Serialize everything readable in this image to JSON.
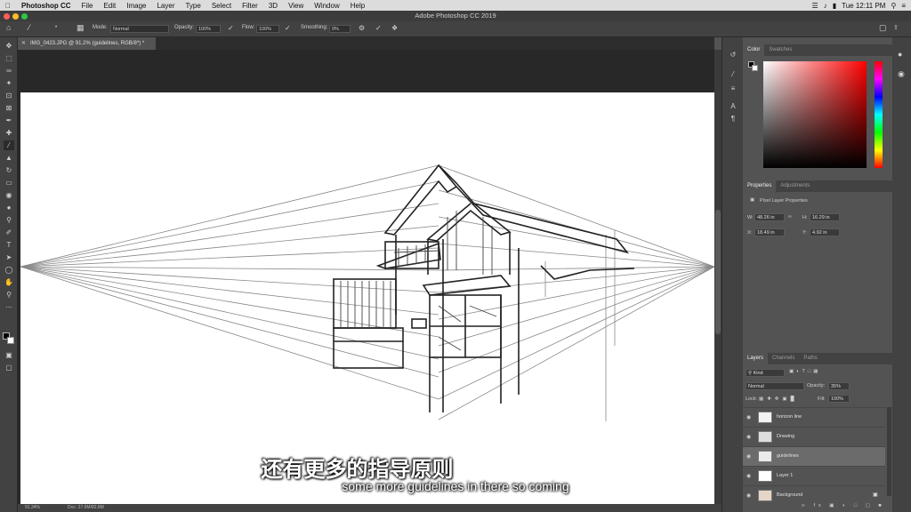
{
  "menubar": {
    "app": "Photoshop CC",
    "items": [
      "File",
      "Edit",
      "Image",
      "Layer",
      "Type",
      "Select",
      "Filter",
      "3D",
      "View",
      "Window",
      "Help"
    ],
    "clock": "Tue 12:11 PM"
  },
  "window": {
    "title": "Adobe Photoshop CC 2019"
  },
  "options": {
    "mode_label": "Mode:",
    "mode_value": "Normal",
    "opacity_label": "Opacity:",
    "opacity_value": "100%",
    "flow_label": "Flow:",
    "flow_value": "100%",
    "smoothing_label": "Smoothing:",
    "smoothing_value": "0%"
  },
  "document": {
    "tab_title": "IMG_0423.JPG @ 91.2% (guidelines, RGB/8*) *"
  },
  "status": {
    "zoom": "91.34%",
    "doc": "Doc: 27.6M/82.8M"
  },
  "color_panel": {
    "tabs": [
      "Color",
      "Swatches"
    ]
  },
  "properties_panel": {
    "tabs": [
      "Properties",
      "Adjustments"
    ],
    "section": "Pixel Layer Properties",
    "w_label": "W:",
    "w_value": "48.26 in",
    "h_label": "H:",
    "h_value": "16.29 in",
    "x_label": "X:",
    "x_value": "18.49 in",
    "y_label": "Y:",
    "y_value": "4.92 in"
  },
  "layers_panel": {
    "tabs": [
      "Layers",
      "Channels",
      "Paths"
    ],
    "kind": "Kind",
    "blend": "Normal",
    "opacity_label": "Opacity:",
    "opacity_value": "35%",
    "lock_label": "Lock:",
    "fill_label": "Fill:",
    "fill_value": "100%",
    "layers": [
      {
        "name": "horizon line"
      },
      {
        "name": "Drawing"
      },
      {
        "name": "guidelines"
      },
      {
        "name": "Layer 1"
      },
      {
        "name": "Background"
      }
    ]
  },
  "subtitles": {
    "cn": "还有更多的指导原则",
    "en": "some more guidelines in there so coming"
  }
}
